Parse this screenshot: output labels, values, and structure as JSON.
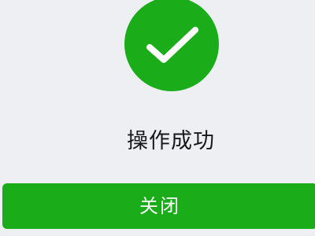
{
  "result": {
    "icon": "check-circle-icon",
    "status_color": "#1aad19",
    "message": "操作成功"
  },
  "actions": {
    "close_label": "关闭"
  }
}
